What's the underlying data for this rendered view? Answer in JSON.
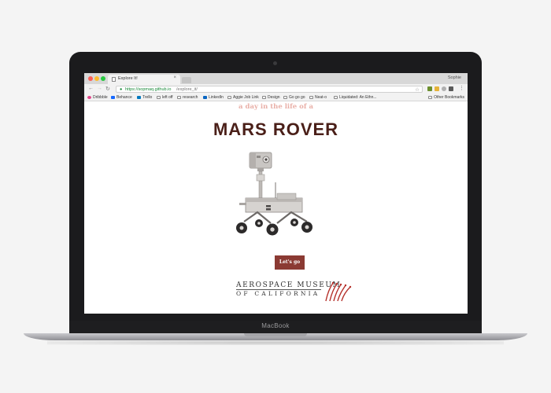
{
  "browser": {
    "tab_title": "Explore It!",
    "tab_close": "×",
    "user_name": "Sophie",
    "url_secure": "https://sopmaq.github.io",
    "url_path": "/explore_it/",
    "nav": {
      "back": "←",
      "forward": "→",
      "reload": "↻"
    },
    "star": "☆",
    "menu": "⋮",
    "lock": "🔒",
    "bookmarks": [
      {
        "label": "Dribbble",
        "icon": "dribbble-icon",
        "color": "#e2488a"
      },
      {
        "label": "Behance",
        "icon": "behance-icon",
        "color": "#1769ff"
      },
      {
        "label": "Trello",
        "icon": "trello-icon",
        "color": "#0079bf"
      },
      {
        "label": "left off",
        "icon": "folder-icon",
        "color": "#ffffff"
      },
      {
        "label": "research",
        "icon": "folder-icon",
        "color": "#ffffff"
      },
      {
        "label": "LinkedIn",
        "icon": "linkedin-icon",
        "color": "#0a66c2"
      },
      {
        "label": "Aggie Job Link",
        "icon": "page-icon",
        "color": "#ffffff"
      },
      {
        "label": "Design",
        "icon": "folder-icon",
        "color": "#ffffff"
      },
      {
        "label": "Go go go",
        "icon": "folder-icon",
        "color": "#ffffff"
      },
      {
        "label": "Neat-o",
        "icon": "folder-icon",
        "color": "#ffffff"
      },
      {
        "label": "Liquidated: An Ethn...",
        "icon": "page-icon",
        "color": "#ffffff"
      }
    ],
    "other_bookmarks": "Other Bookmarks"
  },
  "page": {
    "subtitle": "a day in the life of a",
    "title": "MARS ROVER",
    "cta_label": "Let's go",
    "logo_line1": "AEROSPACE MUSEUM",
    "logo_line2": "OF CALIFORNIA"
  },
  "device": {
    "label": "MacBook"
  },
  "colors": {
    "title": "#4a1f18",
    "subtitle": "#e9b0a8",
    "cta": "#8b3a33",
    "logo_accent": "#b5312b"
  }
}
